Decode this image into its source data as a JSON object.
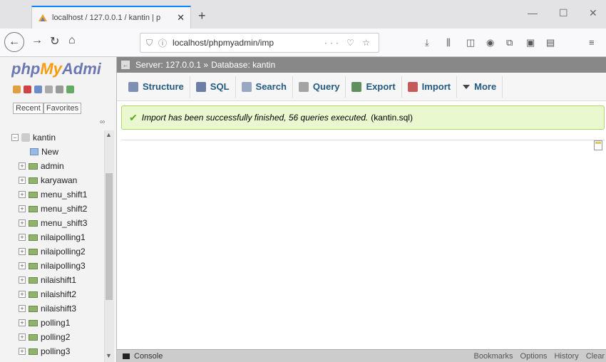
{
  "browser": {
    "tab_title": "localhost / 127.0.0.1 / kantin | p",
    "tab_close": "✕",
    "new_tab": "+",
    "url": "localhost/phpmyadmin/imp",
    "url_more": "··· ♡ ☆",
    "minimize": "—",
    "maximize": "☐",
    "close": "✕"
  },
  "sidebar": {
    "logo_php": "php",
    "logo_my": "My",
    "logo_admin": "Admi",
    "recent_label": "Recent",
    "favorites_label": "Favorites",
    "db_name": "kantin",
    "new_label": "New",
    "tables": [
      "admin",
      "karyawan",
      "menu_shift1",
      "menu_shift2",
      "menu_shift3",
      "nilaipolling1",
      "nilaipolling2",
      "nilaipolling3",
      "nilaishift1",
      "nilaishift2",
      "nilaishift3",
      "polling1",
      "polling2",
      "polling3"
    ]
  },
  "breadcrumb": {
    "server": "Server: 127.0.0.1 »",
    "database": "Database: kantin"
  },
  "menu": [
    {
      "label": "Structure",
      "color": "#7d8fb5"
    },
    {
      "label": "SQL",
      "color": "#6c7ea6"
    },
    {
      "label": "Search",
      "color": "#9aa7c3"
    },
    {
      "label": "Query",
      "color": "#a3a3a3"
    },
    {
      "label": "Export",
      "color": "#5f8f5f"
    },
    {
      "label": "Import",
      "color": "#c45a5a"
    },
    {
      "label": "More",
      "color": "#444444"
    }
  ],
  "message": {
    "text": "Import has been successfully finished, 56 queries executed.",
    "file": "(kantin.sql)"
  },
  "console": {
    "label": "Console",
    "bookmarks": "Bookmarks",
    "options": "Options",
    "history": "History",
    "clear": "Clear"
  }
}
